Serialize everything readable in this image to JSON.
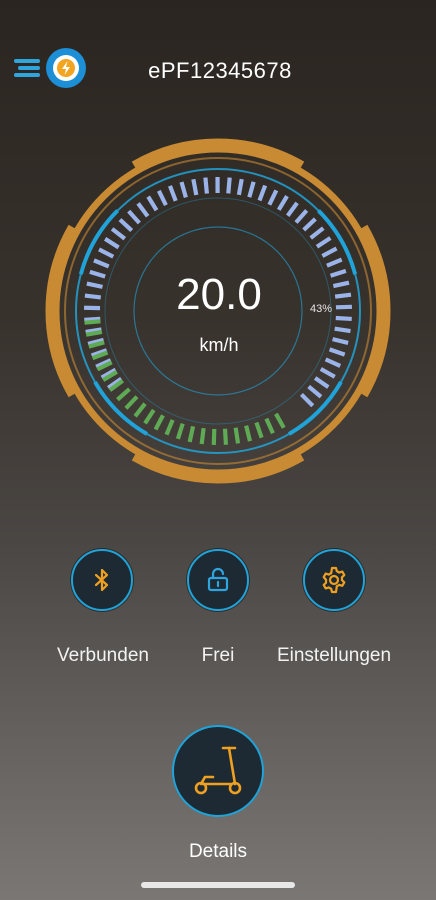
{
  "header": {
    "device_id": "ePF12345678",
    "logo_icon": "scooter-speed-logo-icon"
  },
  "gauge": {
    "speed_value": "20.0",
    "speed_unit": "km/h",
    "battery_percent_label": "43%",
    "battery_level": 0.43,
    "colors": {
      "frame": "#c88a32",
      "ring": "#1fa3d8",
      "speed_segments": "#9ab3e8",
      "battery_segments": "#5faa55"
    }
  },
  "controls": [
    {
      "label": "Verbunden",
      "icon": "bluetooth-icon"
    },
    {
      "label": "Frei",
      "icon": "unlock-icon"
    },
    {
      "label": "Einstellungen",
      "icon": "gear-icon"
    }
  ],
  "details": {
    "label": "Details",
    "icon": "scooter-icon"
  },
  "accent_color": "#f0a020"
}
